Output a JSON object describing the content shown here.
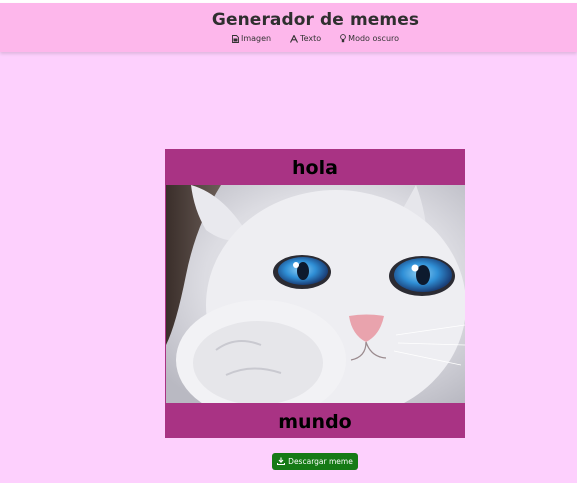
{
  "header": {
    "title": "Generador de memes",
    "nav": [
      {
        "label": "Imagen",
        "icon": "image-file-icon"
      },
      {
        "label": "Texto",
        "icon": "text-font-icon"
      },
      {
        "label": "Modo oscuro",
        "icon": "lightbulb-icon"
      }
    ]
  },
  "meme": {
    "top_text": "hola",
    "bottom_text": "mundo",
    "image_icon": "white-kitten-blue-eyes-photo",
    "background_color": "#a93384"
  },
  "download_button": {
    "label": "Descargar meme",
    "icon": "download-icon",
    "color": "#167a16"
  },
  "colors": {
    "page_background": "#fdd0fd",
    "header_background": "#fdb7eb"
  }
}
